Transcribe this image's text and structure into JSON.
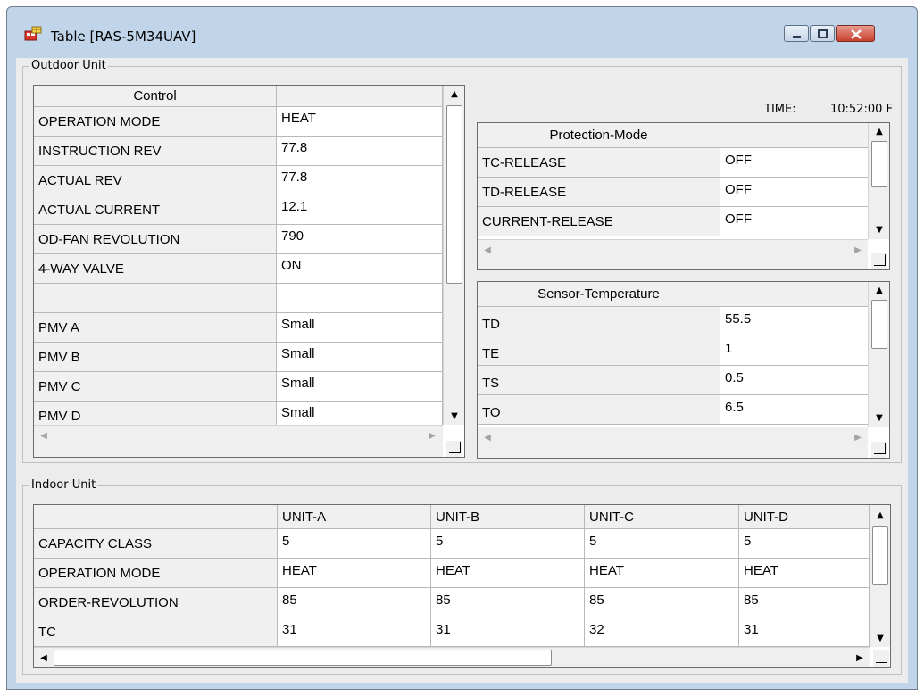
{
  "window": {
    "title": "Table [RAS-5M34UAV]"
  },
  "outdoor": {
    "group_label": "Outdoor Unit",
    "time_label": "TIME:",
    "time_value": "10:52:00 F",
    "control": {
      "headers": [
        "Control",
        ""
      ],
      "rows": [
        [
          "OPERATION MODE",
          "HEAT"
        ],
        [
          "INSTRUCTION REV",
          "77.8"
        ],
        [
          "ACTUAL REV",
          "77.8"
        ],
        [
          "ACTUAL CURRENT",
          "12.1"
        ],
        [
          "OD-FAN REVOLUTION",
          "790"
        ],
        [
          "4-WAY VALVE",
          "ON"
        ],
        [
          "",
          ""
        ],
        [
          "PMV A",
          "Small"
        ],
        [
          "PMV B",
          "Small"
        ],
        [
          "PMV C",
          "Small"
        ],
        [
          "PMV D",
          "Small"
        ]
      ]
    },
    "protection": {
      "headers": [
        "Protection-Mode",
        ""
      ],
      "rows": [
        [
          "TC-RELEASE",
          "OFF"
        ],
        [
          "TD-RELEASE",
          "OFF"
        ],
        [
          "CURRENT-RELEASE",
          "OFF"
        ]
      ]
    },
    "sensor": {
      "headers": [
        "Sensor-Temperature",
        ""
      ],
      "rows": [
        [
          "TD",
          "55.5"
        ],
        [
          "TE",
          "1"
        ],
        [
          "TS",
          "0.5"
        ],
        [
          "TO",
          "6.5"
        ]
      ]
    }
  },
  "indoor": {
    "group_label": "Indoor Unit",
    "headers": [
      "",
      "UNIT-A",
      "UNIT-B",
      "UNIT-C",
      "UNIT-D"
    ],
    "rows": [
      [
        "CAPACITY CLASS",
        "5",
        "5",
        "5",
        "5"
      ],
      [
        "OPERATION MODE",
        "HEAT",
        "HEAT",
        "HEAT",
        "HEAT"
      ],
      [
        "ORDER-REVOLUTION",
        "85",
        "85",
        "85",
        "85"
      ],
      [
        "TC",
        "31",
        "31",
        "32",
        "31"
      ]
    ]
  },
  "colors": {
    "window_frame": "#c1d5ea",
    "client_bg": "#ececec",
    "fixed_cell_bg": "#f0f0f0",
    "close_button": "#c7412e"
  },
  "icons": [
    "table-app-icon",
    "minimize-icon",
    "maximize-icon",
    "close-icon",
    "arrow-up-icon",
    "arrow-down-icon",
    "arrow-left-icon",
    "arrow-right-icon"
  ]
}
